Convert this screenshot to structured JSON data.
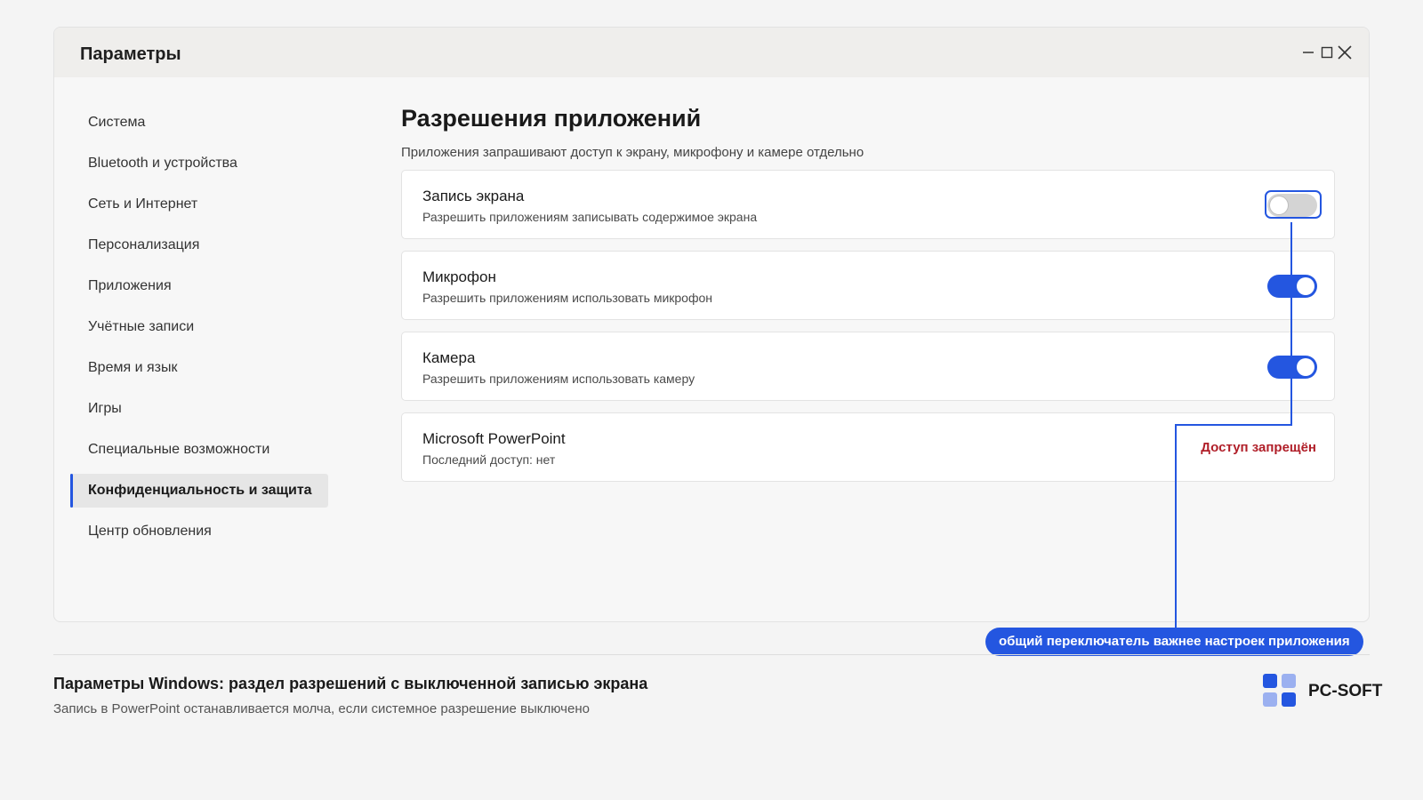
{
  "window": {
    "title": "Параметры"
  },
  "sidebar": {
    "items": [
      {
        "label": "Система"
      },
      {
        "label": "Bluetooth и устройства"
      },
      {
        "label": "Сеть и Интернет"
      },
      {
        "label": "Персонализация"
      },
      {
        "label": "Приложения"
      },
      {
        "label": "Учётные записи"
      },
      {
        "label": "Время и язык"
      },
      {
        "label": "Игры"
      },
      {
        "label": "Специальные возможности"
      },
      {
        "label": "Конфиденциальность и защита",
        "selected": true
      },
      {
        "label": "Центр обновления"
      }
    ]
  },
  "main": {
    "title": "Разрешения приложений",
    "subtitle": "Приложения запрашивают доступ к экрану, микрофону и камере отдельно",
    "settings": [
      {
        "title": "Запись экрана",
        "description": "Разрешить приложениям записывать содержимое экрана",
        "toggle": "off"
      },
      {
        "title": "Микрофон",
        "description": "Разрешить приложениям использовать микрофон",
        "toggle": "on"
      },
      {
        "title": "Камера",
        "description": "Разрешить приложениям использовать камеру",
        "toggle": "on"
      },
      {
        "title": "Microsoft PowerPoint",
        "description": "Последний доступ: нет",
        "status": "Доступ запрещён"
      }
    ]
  },
  "annotation": {
    "callout": "общий переключатель важнее настроек приложения"
  },
  "caption": {
    "title": "Параметры Windows: раздел разрешений с выключенной записью экрана",
    "subtitle": "Запись в PowerPoint останавливается молча, если системное разрешение выключено"
  },
  "brand": {
    "name": "PC-SOFT"
  },
  "colors": {
    "accent": "#2456e0",
    "denied": "#b01e28",
    "logo_light": "#9bb0f0"
  }
}
